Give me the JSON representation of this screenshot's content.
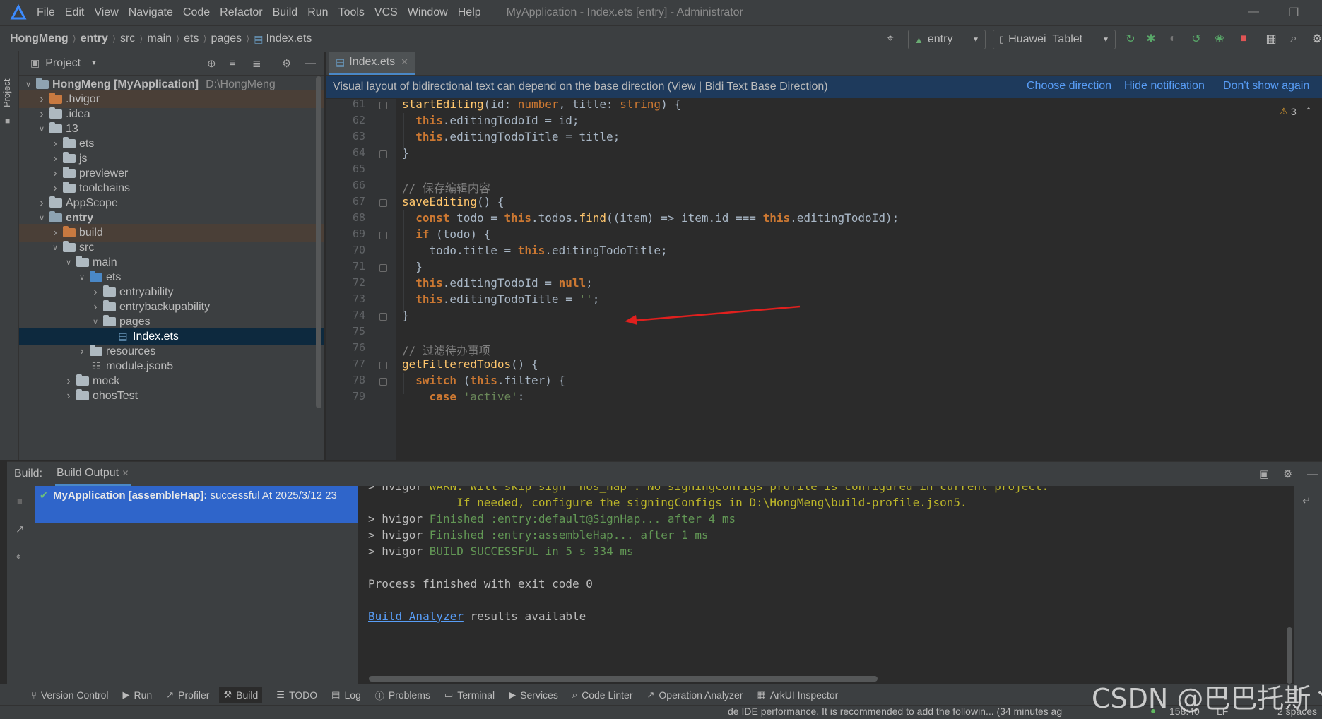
{
  "menu": {
    "items": [
      "File",
      "Edit",
      "View",
      "Navigate",
      "Code",
      "Refactor",
      "Build",
      "Run",
      "Tools",
      "VCS",
      "Window",
      "Help"
    ],
    "window_title": "MyApplication - Index.ets [entry] - Administrator"
  },
  "navbar": {
    "breadcrumbs": [
      "HongMeng",
      "entry",
      "src",
      "main",
      "ets",
      "pages",
      "Index.ets"
    ],
    "run_config": "entry",
    "device": "Huawei_Tablet"
  },
  "project": {
    "title": "Project",
    "tree": [
      {
        "label": "HongMeng [MyApplication]",
        "extra": "D:\\HongMeng",
        "depth": 0,
        "expanded": true,
        "type": "module",
        "bold": true
      },
      {
        "label": ".hvigor",
        "depth": 1,
        "expanded": false,
        "type": "excluded"
      },
      {
        "label": ".idea",
        "depth": 1,
        "expanded": false,
        "type": "folder"
      },
      {
        "label": "13",
        "depth": 1,
        "expanded": true,
        "type": "folder"
      },
      {
        "label": "ets",
        "depth": 2,
        "expanded": false,
        "type": "folder"
      },
      {
        "label": "js",
        "depth": 2,
        "expanded": false,
        "type": "folder"
      },
      {
        "label": "previewer",
        "depth": 2,
        "expanded": false,
        "type": "folder"
      },
      {
        "label": "toolchains",
        "depth": 2,
        "expanded": false,
        "type": "folder"
      },
      {
        "label": "AppScope",
        "depth": 1,
        "expanded": false,
        "type": "folder"
      },
      {
        "label": "entry",
        "depth": 1,
        "expanded": true,
        "type": "module",
        "bold": true
      },
      {
        "label": "build",
        "depth": 2,
        "expanded": false,
        "type": "excluded"
      },
      {
        "label": "src",
        "depth": 2,
        "expanded": true,
        "type": "folder"
      },
      {
        "label": "main",
        "depth": 3,
        "expanded": true,
        "type": "folder"
      },
      {
        "label": "ets",
        "depth": 4,
        "expanded": true,
        "type": "source"
      },
      {
        "label": "entryability",
        "depth": 5,
        "expanded": false,
        "type": "folder"
      },
      {
        "label": "entrybackupability",
        "depth": 5,
        "expanded": false,
        "type": "folder"
      },
      {
        "label": "pages",
        "depth": 5,
        "expanded": true,
        "type": "folder"
      },
      {
        "label": "Index.ets",
        "depth": 6,
        "type": "file",
        "selected": true
      },
      {
        "label": "resources",
        "depth": 4,
        "expanded": false,
        "type": "folder"
      },
      {
        "label": "module.json5",
        "depth": 4,
        "type": "json"
      },
      {
        "label": "mock",
        "depth": 3,
        "expanded": false,
        "type": "folder"
      },
      {
        "label": "ohosTest",
        "depth": 3,
        "expanded": false,
        "type": "folder"
      }
    ]
  },
  "editor": {
    "tab": "Index.ets",
    "notification": "Visual layout of bidirectional text can depend on the base direction (View | Bidi Text Base Direction)",
    "notification_actions": [
      "Choose direction",
      "Hide notification",
      "Don't show again"
    ],
    "warnings_count": "3",
    "lines": [
      {
        "n": "61",
        "tokens": [
          [
            "fn",
            "startEditing"
          ],
          [
            "tx",
            "(id: "
          ],
          [
            "ty",
            "number"
          ],
          [
            "tx",
            ", title: "
          ],
          [
            "ty",
            "string"
          ],
          [
            "tx",
            ") {"
          ]
        ]
      },
      {
        "n": "62",
        "tokens": [
          [
            "tx",
            "  "
          ],
          [
            "kw",
            "this"
          ],
          [
            "tx",
            ".editingTodoId = id;"
          ]
        ]
      },
      {
        "n": "63",
        "tokens": [
          [
            "tx",
            "  "
          ],
          [
            "kw",
            "this"
          ],
          [
            "tx",
            ".editingTodoTitle = title;"
          ]
        ]
      },
      {
        "n": "64",
        "tokens": [
          [
            "tx",
            "}"
          ]
        ]
      },
      {
        "n": "65",
        "tokens": []
      },
      {
        "n": "66",
        "tokens": [
          [
            "cm",
            "// 保存编辑内容"
          ]
        ]
      },
      {
        "n": "67",
        "tokens": [
          [
            "fn",
            "saveEditing"
          ],
          [
            "tx",
            "() {"
          ]
        ]
      },
      {
        "n": "68",
        "tokens": [
          [
            "tx",
            "  "
          ],
          [
            "kw",
            "const"
          ],
          [
            "tx",
            " todo = "
          ],
          [
            "kw",
            "this"
          ],
          [
            "tx",
            ".todos."
          ],
          [
            "fn",
            "find"
          ],
          [
            "tx",
            "((item) => item.id === "
          ],
          [
            "kw",
            "this"
          ],
          [
            "tx",
            ".editingTodoId);"
          ]
        ]
      },
      {
        "n": "69",
        "tokens": [
          [
            "tx",
            "  "
          ],
          [
            "kw",
            "if"
          ],
          [
            "tx",
            " (todo) {"
          ]
        ]
      },
      {
        "n": "70",
        "tokens": [
          [
            "tx",
            "    todo.title = "
          ],
          [
            "kw",
            "this"
          ],
          [
            "tx",
            ".editingTodoTitle;"
          ]
        ]
      },
      {
        "n": "71",
        "tokens": [
          [
            "tx",
            "  }"
          ]
        ]
      },
      {
        "n": "72",
        "tokens": [
          [
            "tx",
            "  "
          ],
          [
            "kw",
            "this"
          ],
          [
            "tx",
            ".editingTodoId = "
          ],
          [
            "kw",
            "null"
          ],
          [
            "tx",
            ";"
          ]
        ]
      },
      {
        "n": "73",
        "tokens": [
          [
            "tx",
            "  "
          ],
          [
            "kw",
            "this"
          ],
          [
            "tx",
            ".editingTodoTitle = "
          ],
          [
            "str",
            "''"
          ],
          [
            "tx",
            ";"
          ]
        ]
      },
      {
        "n": "74",
        "tokens": [
          [
            "tx",
            "}"
          ]
        ]
      },
      {
        "n": "75",
        "tokens": []
      },
      {
        "n": "76",
        "tokens": [
          [
            "cm",
            "// 过滤待办事项"
          ]
        ]
      },
      {
        "n": "77",
        "tokens": [
          [
            "fn",
            "getFilteredTodos"
          ],
          [
            "tx",
            "() {"
          ]
        ]
      },
      {
        "n": "78",
        "tokens": [
          [
            "tx",
            "  "
          ],
          [
            "kw",
            "switch"
          ],
          [
            "tx",
            " ("
          ],
          [
            "kw",
            "this"
          ],
          [
            "tx",
            ".filter) {"
          ]
        ]
      },
      {
        "n": "79",
        "tokens": [
          [
            "tx",
            "    "
          ],
          [
            "kw",
            "case"
          ],
          [
            "tx",
            " "
          ],
          [
            "str",
            "'active'"
          ],
          [
            "tx",
            ":"
          ]
        ]
      }
    ]
  },
  "build": {
    "label": "Build:",
    "tab": "Build Output",
    "task_title": "MyApplication [assembleHap]:",
    "task_status": "successful At 2025/3/12 23",
    "output": [
      {
        "cls": "mixed",
        "prefix": "> hvigor ",
        "text": "WARN: Will skip sign 'hos_hap'. No signingConfigs profile is configured in current project.",
        "style": "warn"
      },
      {
        "cls": "warn",
        "prefix": "",
        "text": "             If needed, configure the signingConfigs in D:\\HongMeng\\build-profile.json5.",
        "style": "warn"
      },
      {
        "cls": "mixed",
        "prefix": "> hvigor ",
        "text": "Finished :entry:default@SignHap... after 4 ms",
        "style": "grn"
      },
      {
        "cls": "mixed",
        "prefix": "> hvigor ",
        "text": "Finished :entry:assembleHap... after 1 ms",
        "style": "grn"
      },
      {
        "cls": "mixed",
        "prefix": "> hvigor ",
        "text": "BUILD SUCCESSFUL in 5 s 334 ms",
        "style": "grn"
      },
      {
        "cls": "plain",
        "prefix": "",
        "text": "",
        "style": "tx"
      },
      {
        "cls": "plain",
        "prefix": "",
        "text": "Process finished with exit code 0",
        "style": "tx"
      },
      {
        "cls": "plain",
        "prefix": "",
        "text": "",
        "style": "tx"
      }
    ],
    "analyzer_link": "Build Analyzer",
    "analyzer_rest": " results available"
  },
  "bottom_tools": [
    {
      "label": "Version Control",
      "icon": "branch-icon"
    },
    {
      "label": "Run",
      "icon": "run-icon"
    },
    {
      "label": "Profiler",
      "icon": "profiler-icon"
    },
    {
      "label": "Build",
      "icon": "hammer-icon",
      "active": true
    },
    {
      "label": "TODO",
      "icon": "list-icon"
    },
    {
      "label": "Log",
      "icon": "log-icon"
    },
    {
      "label": "Problems",
      "icon": "problems-icon"
    },
    {
      "label": "Terminal",
      "icon": "terminal-icon"
    },
    {
      "label": "Services",
      "icon": "services-icon"
    },
    {
      "label": "Code Linter",
      "icon": "linter-icon"
    },
    {
      "label": "Operation Analyzer",
      "icon": "analyzer-icon"
    },
    {
      "label": "ArkUI Inspector",
      "icon": "inspector-icon"
    }
  ],
  "status": {
    "message": "de IDE performance. It is recommended to add the followin... (34 minutes ag",
    "position": "158:40",
    "line_sep": "LF",
    "indent": "2 spaces"
  },
  "watermark": "CSDN @巴巴托斯丶",
  "colors": {
    "accent": "#4a88c7",
    "selection": "#2f65ca",
    "arrow": "#e0201e"
  }
}
